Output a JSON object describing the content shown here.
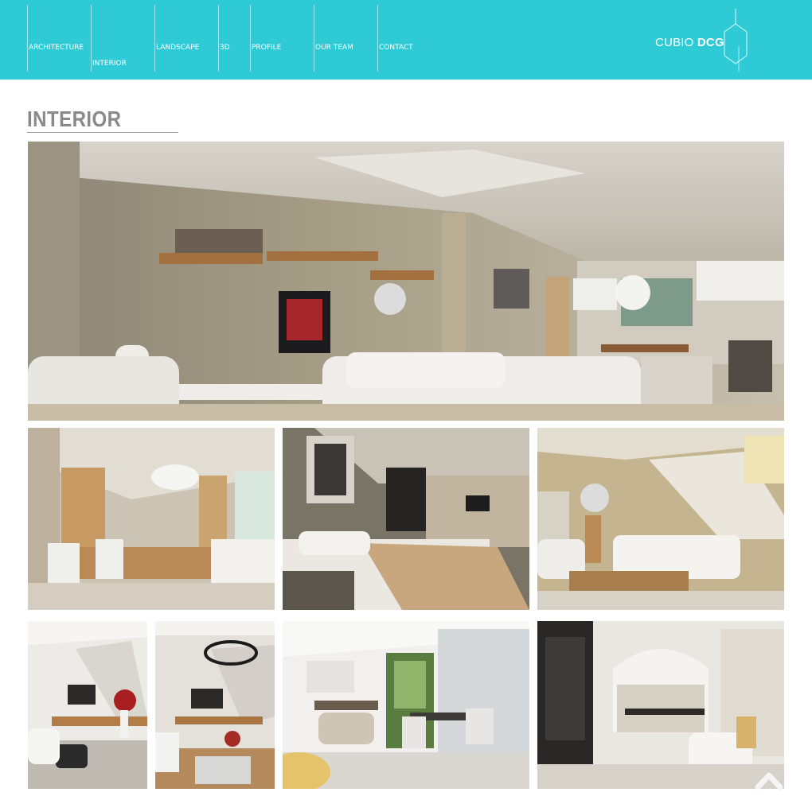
{
  "nav": {
    "items": [
      {
        "label": "ARCHITECTURE"
      },
      {
        "label": "INTERIOR"
      },
      {
        "label": "LANDSCAPE"
      },
      {
        "label": "3D"
      },
      {
        "label": "PROFILE"
      },
      {
        "label": "OUR TEAM"
      },
      {
        "label": "CONTACT"
      }
    ]
  },
  "logo": {
    "light": "CUBIO",
    "bold": "DCG"
  },
  "page": {
    "title": "INTERIOR"
  },
  "gallery": {
    "hero": {
      "icon": "living-room-image"
    },
    "row2": [
      {
        "icon": "dining-room-image"
      },
      {
        "icon": "bedroom-image"
      },
      {
        "icon": "staircase-lounge-image"
      }
    ],
    "row3": [
      {
        "icon": "living-flowers-image"
      },
      {
        "icon": "chandelier-living-image"
      },
      {
        "icon": "white-lounge-image"
      },
      {
        "icon": "classic-dining-image"
      }
    ]
  },
  "colors": {
    "header": "#2ecbd7",
    "title": "#8a8a8a"
  },
  "scroll_top": {
    "icon": "chevron-up-icon"
  }
}
